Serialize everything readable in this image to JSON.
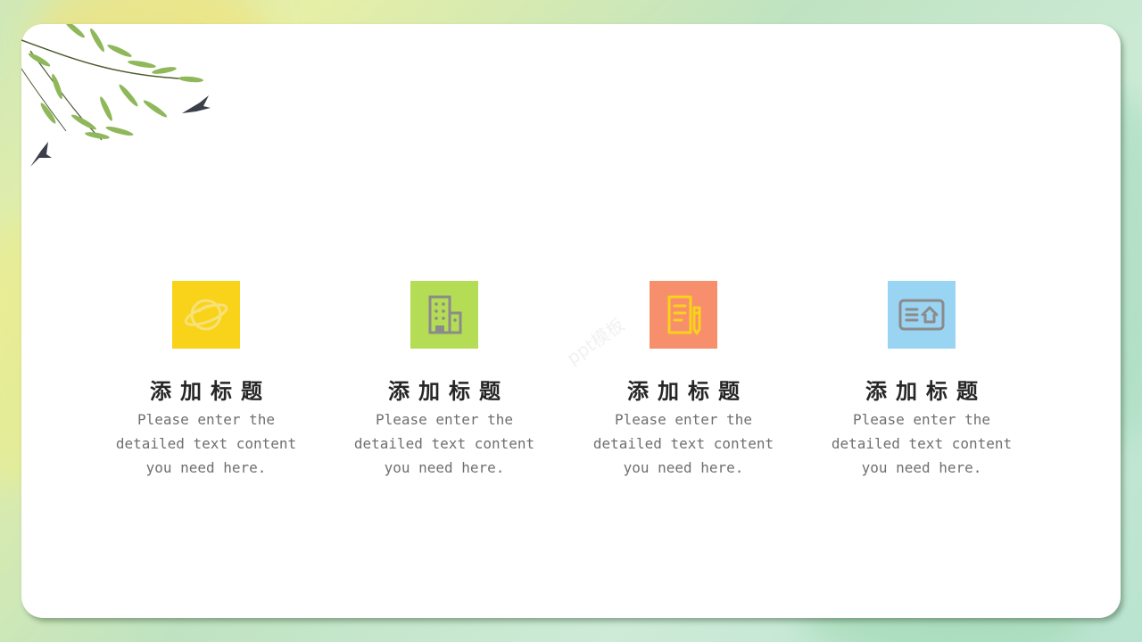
{
  "features": [
    {
      "title": "添加标题",
      "description": "Please enter the\ndetailed text content\nyou need here.",
      "icon": "planet-icon",
      "color": "#f9d21a"
    },
    {
      "title": "添加标题",
      "description": "Please enter the\ndetailed text content\nyou need here.",
      "icon": "building-icon",
      "color": "#b4dd55"
    },
    {
      "title": "添加标题",
      "description": "Please enter the\ndetailed text content\nyou need here.",
      "icon": "document-pencil-icon",
      "color": "#f88f6c"
    },
    {
      "title": "添加标题",
      "description": "Please enter the\ndetailed text content\nyou need here.",
      "icon": "card-home-icon",
      "color": "#9ad4f3"
    }
  ],
  "watermark": "ppt模板"
}
